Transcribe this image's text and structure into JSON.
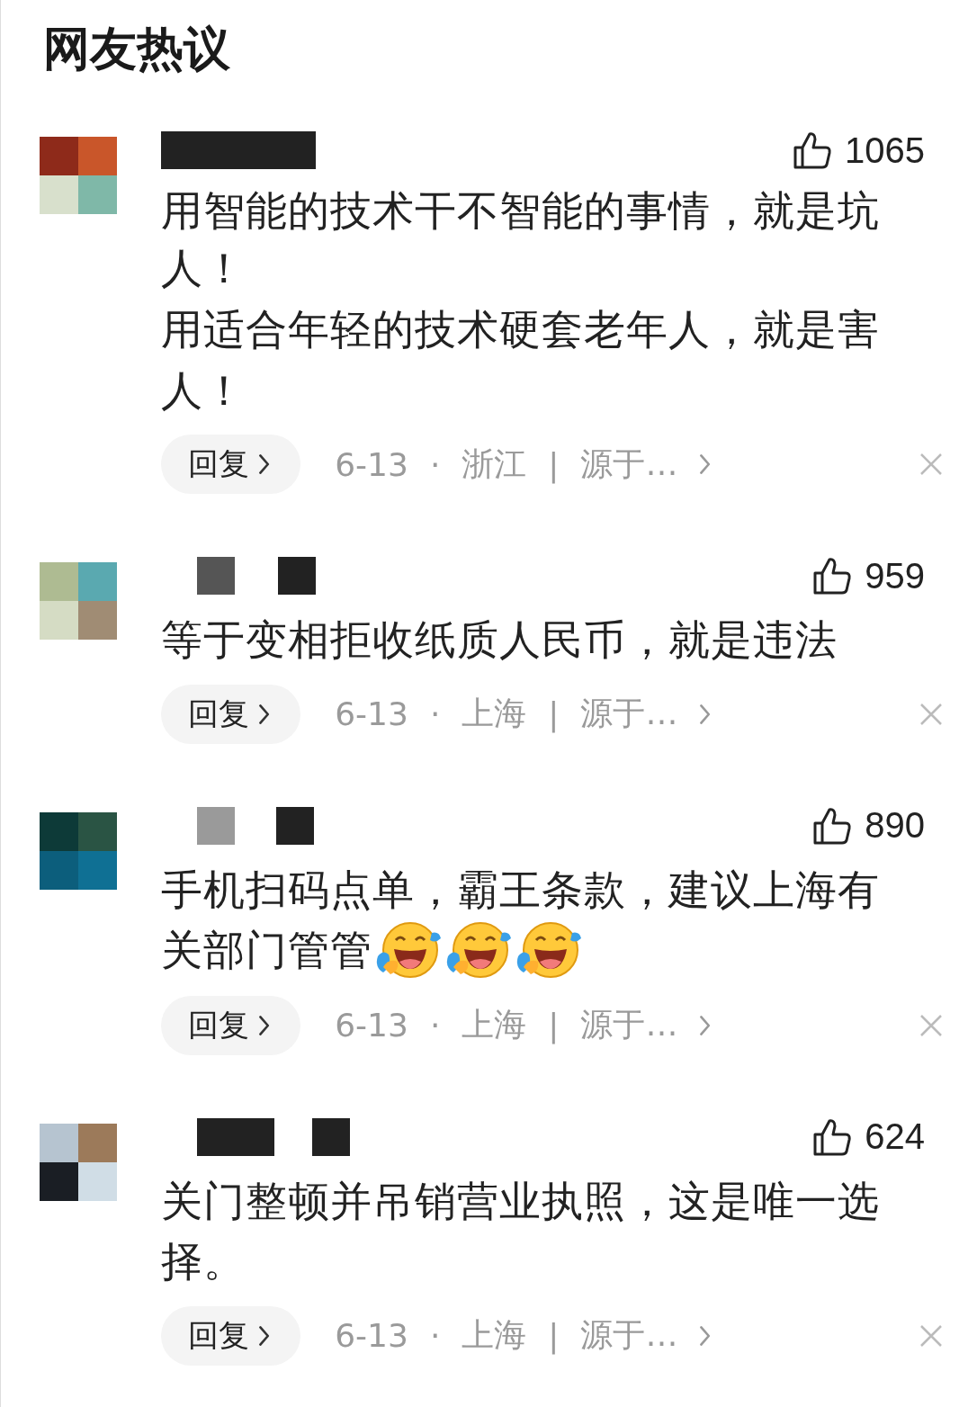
{
  "title": "网友热议",
  "comments": [
    {
      "likes": "1065",
      "lines": [
        "用智能的技术干不智能的事情，就是坑人！",
        "用适合年轻的技术硬套老年人，就是害人！"
      ],
      "reply": "回复",
      "date": "6-13",
      "dot": "·",
      "location": "浙江",
      "divider": "|",
      "source": "源于…"
    },
    {
      "likes": "959",
      "lines": [
        "等于变相拒收纸质人民币，就是违法"
      ],
      "reply": "回复",
      "date": "6-13",
      "dot": "·",
      "location": "上海",
      "divider": "|",
      "source": "源于…"
    },
    {
      "likes": "890",
      "lines": [
        "手机扫码点单，霸王条款，建议上海有关部门管管"
      ],
      "emojis": [
        {
          "kind": "laugh-cry"
        },
        {
          "kind": "laugh-cry"
        },
        {
          "kind": "laugh-cry"
        }
      ],
      "reply": "回复",
      "date": "6-13",
      "dot": "·",
      "location": "上海",
      "divider": "|",
      "source": "源于…"
    },
    {
      "likes": "624",
      "lines": [
        "关门整顿并吊销营业执照，这是唯一选择。"
      ],
      "reply": "回复",
      "date": "6-13",
      "dot": "·",
      "location": "上海",
      "divider": "|",
      "source": "源于…"
    }
  ]
}
